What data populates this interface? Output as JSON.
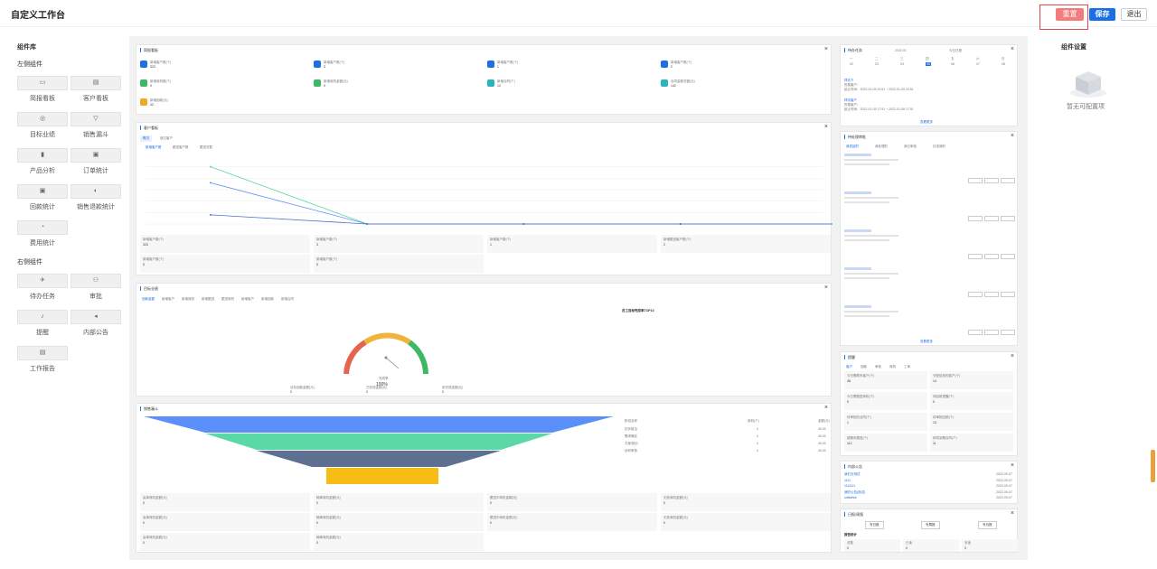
{
  "header": {
    "title": "自定义工作台",
    "reset": "重置",
    "save": "保存",
    "exit": "退出"
  },
  "library": {
    "title": "组件库",
    "left_group": "左侧组件",
    "right_group": "右侧组件",
    "left_items": [
      "简报看板",
      "客户看板",
      "目标业绩",
      "销售漏斗",
      "产品分析",
      "订单统计",
      "回款统计",
      "销售退款统计",
      "费用统计"
    ],
    "right_items": [
      "待办任务",
      "审批",
      "提醒",
      "内部公告",
      "工作报告"
    ]
  },
  "settings": {
    "title": "组件设置",
    "empty": "暂无可配置项"
  },
  "cards": {
    "briefing": {
      "title": "简报看板",
      "items": [
        {
          "label": "新增客户数(个)",
          "value": "323"
        },
        {
          "label": "新增客户数(个)",
          "value": "3"
        },
        {
          "label": "新增客户数(个)",
          "value": "1"
        },
        {
          "label": "新增客户数(个)",
          "value": "2"
        },
        {
          "label": "新增商机数(个)",
          "value": "0"
        },
        {
          "label": "新增商机金额(元)",
          "value": "0"
        },
        {
          "label": "新增合同(个)",
          "value": "12"
        },
        {
          "label": "合同金额总额(元)",
          "value": "142"
        },
        {
          "label": "新增回款(元)",
          "value": "42"
        }
      ]
    },
    "customer": {
      "title": "客户看板",
      "tabs": [
        "概况",
        "遗忘客户"
      ],
      "legend": [
        "新增客户数",
        "跟进客户数",
        "跟进次数"
      ],
      "stats": [
        {
          "label": "新增客户数(个)",
          "value": "323"
        },
        {
          "label": "新增客户数(个)",
          "value": "3"
        },
        {
          "label": "新增客户数(个)",
          "value": "1"
        },
        {
          "label": "新增跟进客户数(个)",
          "value": "2"
        },
        {
          "label": "新增客户数(个)",
          "value": "0"
        },
        {
          "label": "新增客户数(个)",
          "value": "0"
        }
      ]
    },
    "target": {
      "title": "目标业绩",
      "tabs": [
        "回款金额",
        "新增客户",
        "新增商机",
        "新增跟进",
        "跟进商机",
        "新增客户",
        "新增回款",
        "新增合同"
      ],
      "rank_title": "员工目标完成率TOP10",
      "gauge_label": "完成率",
      "gauge_value": "100%",
      "stats": [
        {
          "label": "目标回款金额(元)",
          "value": "0"
        },
        {
          "label": "已完成金额(元)",
          "value": "0"
        },
        {
          "label": "未完成金额(元)",
          "value": "0"
        }
      ]
    },
    "funnel": {
      "title": "销售漏斗",
      "table_head": [
        "阶段名称",
        "商机(个)",
        "金额(元)"
      ],
      "rows": [
        [
          "初步接洽",
          "0",
          "40.00"
        ],
        [
          "需求确定",
          "0",
          "40.00"
        ],
        [
          "方案/报价",
          "0",
          "40.00"
        ],
        [
          "谈判审核",
          "0",
          "40.00"
        ]
      ],
      "stats": [
        {
          "label": "赢单商机金额(元)",
          "value": "0"
        },
        {
          "label": "输单商机金额(元)",
          "value": "0"
        },
        {
          "label": "跟进中商机金额(元)",
          "value": "0"
        },
        {
          "label": "无效商机金额(元)",
          "value": "0"
        },
        {
          "label": "赢单商机金额(元)",
          "value": "0"
        },
        {
          "label": "输单商机金额(元)",
          "value": "0"
        },
        {
          "label": "跟进中商机金额(元)",
          "value": "0"
        },
        {
          "label": "无效商机金额(元)",
          "value": "0"
        },
        {
          "label": "赢单商机金额(元)",
          "value": "0"
        },
        {
          "label": "输单商机金额(元)",
          "value": "0"
        }
      ]
    },
    "todo": {
      "title": "待办任务",
      "month": "2022-01",
      "today": "今日日程",
      "weekdays": [
        "一",
        "二",
        "三",
        "四",
        "五",
        "六",
        "日"
      ],
      "days": [
        "02",
        "03",
        "04",
        "05",
        "06",
        "07",
        "08"
      ],
      "tasks": [
        {
          "title": "拜访下",
          "customer": "所属客户：",
          "time": "起止时间：2022-01-05 20:51 ~ 2022-01-05 20:51"
        },
        {
          "title": "拜访客户",
          "customer": "所属客户：",
          "time": "起止时间：2022-01-05 17:51 ~ 2022-01-06 17:51"
        }
      ],
      "more": "查看更多"
    },
    "approval": {
      "title": "待处理审批",
      "tabs": [
        "我发起的",
        "我处理的",
        "我已审批",
        "抄送我的"
      ],
      "more": "查看更多"
    },
    "remind": {
      "title": "提醒",
      "tabs": [
        "客户",
        "回款",
        "审批",
        "商机",
        "工单"
      ],
      "stats": [
        {
          "label": "今日需联系客户(个)",
          "value": "38"
        },
        {
          "label": "分配给我的客户(个)",
          "value": "14"
        },
        {
          "label": "今日需跟进商机(个)",
          "value": "0"
        },
        {
          "label": "待回款提醒(个)",
          "value": "0"
        },
        {
          "label": "待审批的合同(个)",
          "value": "1"
        },
        {
          "label": "待审批回款(个)",
          "value": "13"
        },
        {
          "label": "超期未跟进(个)",
          "value": "112"
        },
        {
          "label": "即将到期合同(个)",
          "value": "11"
        }
      ]
    },
    "notice": {
      "title": "内部公告",
      "items": [
        {
          "title": "我们去测试",
          "date": "2022-09-07"
        },
        {
          "title": "1111",
          "date": "2022-09-07"
        },
        {
          "title": "1111111",
          "date": "2022-09-07"
        },
        {
          "title": "我的公告(测试)",
          "date": "2022-09-07"
        },
        {
          "title": "sdfsdfsfs",
          "date": "2022-09-07"
        }
      ]
    },
    "report": {
      "title": "日报/周报",
      "buttons": [
        "写日报",
        "写周报",
        "写月报"
      ],
      "section": "报告统计",
      "stats": [
        {
          "label": "总数",
          "value": "0"
        },
        {
          "label": "已读",
          "value": "0"
        },
        {
          "label": "未读",
          "value": "0"
        }
      ]
    }
  },
  "chart_data": {
    "type": "line",
    "series": [
      {
        "name": "新增客户数",
        "color": "#5fd3a6",
        "values": [
          5,
          0,
          0,
          0,
          0
        ]
      },
      {
        "name": "跟进客户数",
        "color": "#5b8ff9",
        "values": [
          3.6,
          0,
          0,
          0,
          0
        ]
      },
      {
        "name": "跟进次数",
        "color": "#5470c6",
        "values": [
          0.8,
          0,
          0,
          0,
          0
        ]
      }
    ],
    "ylim": [
      0,
      6
    ]
  }
}
